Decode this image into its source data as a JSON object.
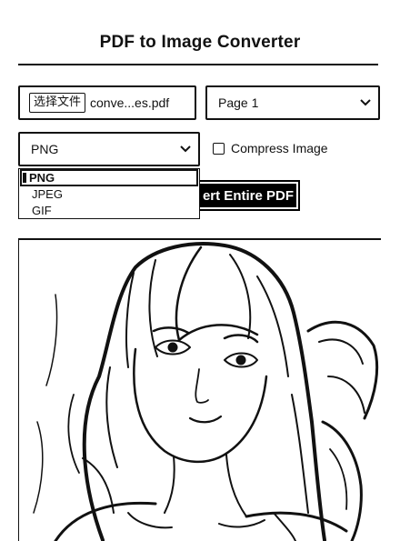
{
  "header": {
    "title": "PDF to Image Converter"
  },
  "file_input": {
    "button_label": "选择文件",
    "file_name": "conve...es.pdf"
  },
  "page_select": {
    "value": "Page 1"
  },
  "format_select": {
    "value": "PNG",
    "options": [
      "PNG",
      "JPEG",
      "GIF"
    ]
  },
  "compress": {
    "label": "Compress Image",
    "checked": false
  },
  "convert_button": {
    "label": "ert Entire PDF"
  },
  "icons": {
    "dropdown": "chevron-down-icon",
    "preview": "illustration-image"
  }
}
